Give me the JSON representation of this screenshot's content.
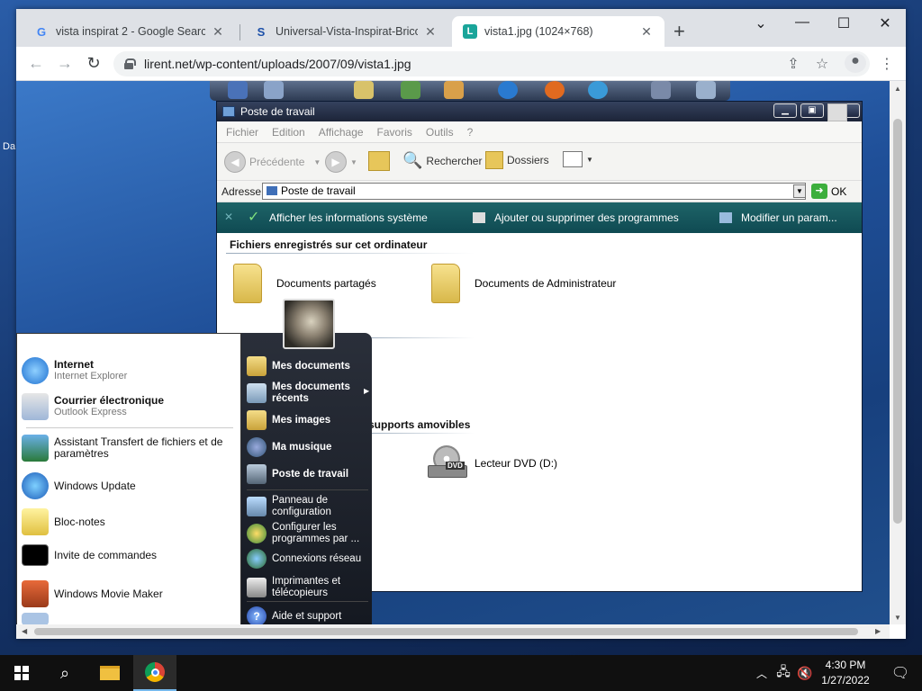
{
  "host": {
    "edge_text": "Da"
  },
  "chrome": {
    "tabs": [
      {
        "title": "vista inspirat 2 - Google Search",
        "favicon": "G",
        "favicon_color": "#4285f4"
      },
      {
        "title": "Universal-Vista-Inspirat-Brico-Pa",
        "favicon": "S",
        "favicon_color": "#1b4fa8"
      },
      {
        "title": "vista1.jpg (1024×768)",
        "favicon": "L",
        "favicon_color": "#1aa59a"
      }
    ],
    "url": "lirent.net/wp-content/uploads/2007/09/vista1.jpg"
  },
  "xp": {
    "window_title": "Poste de travail",
    "menu": [
      "Fichier",
      "Edition",
      "Affichage",
      "Favoris",
      "Outils",
      "?"
    ],
    "toolbar": {
      "back": "Précédente",
      "search": "Rechercher",
      "folders": "Dossiers"
    },
    "address": {
      "label": "Adresse",
      "value": "Poste de travail",
      "go": "OK"
    },
    "tasks": [
      "Afficher les informations système",
      "Ajouter ou supprimer des programmes",
      "Modifier un param..."
    ],
    "groups": {
      "files_header": "Fichiers enregistrés sur cet ordinateur",
      "removable_header": "supports amovibles"
    },
    "items": {
      "shared": "Documents partagés",
      "admin": "Documents de Administrateur",
      "dvd": "Lecteur DVD (D:)",
      "dvd_badge": "DVD"
    }
  },
  "startmenu": {
    "pinned": [
      {
        "title": "Internet",
        "sub": "Internet Explorer"
      },
      {
        "title": "Courrier électronique",
        "sub": "Outlook Express"
      }
    ],
    "recent": [
      "Assistant Transfert de fichiers et de paramètres",
      "Windows Update",
      "Bloc-notes",
      "Invite de commandes",
      "Windows Movie Maker"
    ],
    "right_top": [
      "Mes documents",
      "Mes documents récents",
      "Mes images",
      "Ma musique",
      "Poste de travail"
    ],
    "right_mid": [
      "Panneau de configuration",
      "Configurer les programmes par ...",
      "Connexions réseau",
      "Imprimantes et télécopieurs"
    ],
    "right_bottom": [
      "Aide et support"
    ]
  },
  "taskbar": {
    "time": "4:30 PM",
    "date": "1/27/2022"
  }
}
